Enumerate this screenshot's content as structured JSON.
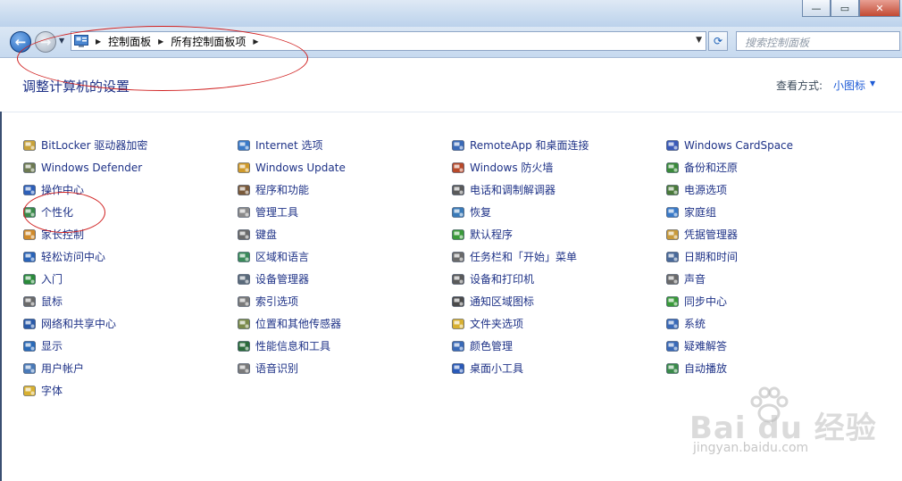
{
  "window": {
    "minimize_label": "—",
    "maximize_label": "▭",
    "close_label": "✕"
  },
  "nav": {
    "back_glyph": "←",
    "forward_glyph": "→",
    "recent_glyph": "▼",
    "breadcrumb": [
      "控制面板",
      "所有控制面板项"
    ],
    "refresh_glyph": "⟳",
    "search_placeholder": "搜索控制面板"
  },
  "header": {
    "title": "调整计算机的设置",
    "view_by_label": "查看方式:",
    "view_by_value": "小图标",
    "view_by_arrow": "▼"
  },
  "columns": [
    [
      {
        "label": "BitLocker 驱动器加密",
        "icon": "bitlocker-icon",
        "color": "#c8a23a"
      },
      {
        "label": "Windows Defender",
        "icon": "defender-icon",
        "color": "#6d7a52"
      },
      {
        "label": "操作中心",
        "icon": "action-center-flag-icon",
        "color": "#2d5fb8"
      },
      {
        "label": "个性化",
        "icon": "personalization-icon",
        "color": "#3a8a4a"
      },
      {
        "label": "家长控制",
        "icon": "parental-controls-icon",
        "color": "#d08a2a"
      },
      {
        "label": "轻松访问中心",
        "icon": "ease-of-access-icon",
        "color": "#2a64b8"
      },
      {
        "label": "入门",
        "icon": "getting-started-icon",
        "color": "#2a8a3a"
      },
      {
        "label": "鼠标",
        "icon": "mouse-icon",
        "color": "#6a6a6a"
      },
      {
        "label": "网络和共享中心",
        "icon": "network-sharing-icon",
        "color": "#2a5aa8"
      },
      {
        "label": "显示",
        "icon": "display-icon",
        "color": "#2a6ab8"
      },
      {
        "label": "用户帐户",
        "icon": "user-accounts-icon",
        "color": "#4a7ab8"
      },
      {
        "label": "字体",
        "icon": "fonts-folder-icon",
        "color": "#d8b030"
      }
    ],
    [
      {
        "label": "Internet 选项",
        "icon": "internet-options-icon",
        "color": "#3a7ac8"
      },
      {
        "label": "Windows Update",
        "icon": "windows-update-icon",
        "color": "#d09a2a"
      },
      {
        "label": "程序和功能",
        "icon": "programs-features-icon",
        "color": "#7a5a3a"
      },
      {
        "label": "管理工具",
        "icon": "admin-tools-icon",
        "color": "#8a8a8a"
      },
      {
        "label": "键盘",
        "icon": "keyboard-icon",
        "color": "#6a6a6a"
      },
      {
        "label": "区域和语言",
        "icon": "region-language-icon",
        "color": "#3a8a5a"
      },
      {
        "label": "设备管理器",
        "icon": "device-manager-icon",
        "color": "#5a6a7a"
      },
      {
        "label": "索引选项",
        "icon": "indexing-options-icon",
        "color": "#7a7a7a"
      },
      {
        "label": "位置和其他传感器",
        "icon": "location-sensors-icon",
        "color": "#7a8a4a"
      },
      {
        "label": "性能信息和工具",
        "icon": "performance-icon",
        "color": "#2a6a3a"
      },
      {
        "label": "语音识别",
        "icon": "speech-recognition-icon",
        "color": "#7a7a7a"
      }
    ],
    [
      {
        "label": "RemoteApp 和桌面连接",
        "icon": "remoteapp-icon",
        "color": "#3a6ab8"
      },
      {
        "label": "Windows 防火墙",
        "icon": "firewall-icon",
        "color": "#b84a2a"
      },
      {
        "label": "电话和调制解调器",
        "icon": "phone-modem-icon",
        "color": "#5a5a5a"
      },
      {
        "label": "恢复",
        "icon": "recovery-icon",
        "color": "#3a7ab8"
      },
      {
        "label": "默认程序",
        "icon": "default-programs-icon",
        "color": "#3a9a3a"
      },
      {
        "label": "任务栏和「开始」菜单",
        "icon": "taskbar-start-icon",
        "color": "#6a6a6a"
      },
      {
        "label": "设备和打印机",
        "icon": "devices-printers-icon",
        "color": "#5a5a5a"
      },
      {
        "label": "通知区域图标",
        "icon": "notification-area-icon",
        "color": "#4a4a4a"
      },
      {
        "label": "文件夹选项",
        "icon": "folder-options-icon",
        "color": "#d8b030"
      },
      {
        "label": "颜色管理",
        "icon": "color-management-icon",
        "color": "#3a6ab8"
      },
      {
        "label": "桌面小工具",
        "icon": "desktop-gadgets-icon",
        "color": "#2a5ab8"
      }
    ],
    [
      {
        "label": "Windows CardSpace",
        "icon": "cardspace-icon",
        "color": "#3a5ab8"
      },
      {
        "label": "备份和还原",
        "icon": "backup-restore-icon",
        "color": "#3a8a3a"
      },
      {
        "label": "电源选项",
        "icon": "power-options-icon",
        "color": "#4a7a3a"
      },
      {
        "label": "家庭组",
        "icon": "homegroup-icon",
        "color": "#3a7ac8"
      },
      {
        "label": "凭据管理器",
        "icon": "credential-manager-icon",
        "color": "#c89a3a"
      },
      {
        "label": "日期和时间",
        "icon": "date-time-icon",
        "color": "#4a6a9a"
      },
      {
        "label": "声音",
        "icon": "sound-icon",
        "color": "#6a6a6a"
      },
      {
        "label": "同步中心",
        "icon": "sync-center-icon",
        "color": "#3a9a3a"
      },
      {
        "label": "系统",
        "icon": "system-icon",
        "color": "#3a6ab8"
      },
      {
        "label": "疑难解答",
        "icon": "troubleshooting-icon",
        "color": "#3a6ab8"
      },
      {
        "label": "自动播放",
        "icon": "autoplay-icon",
        "color": "#3a8a4a"
      }
    ]
  ],
  "watermark": {
    "brand": "Bai du 经验",
    "url": "jingyan.baidu.com"
  }
}
